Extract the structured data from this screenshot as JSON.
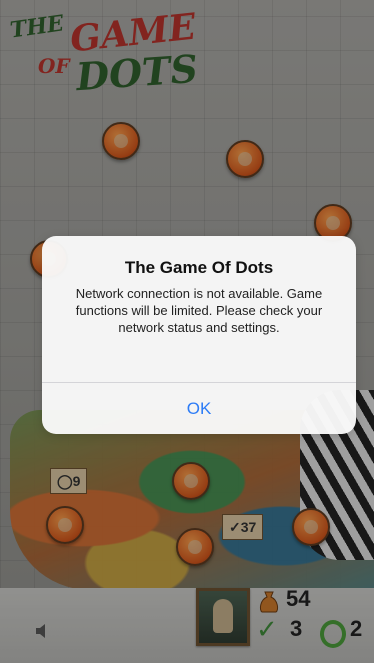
{
  "alert": {
    "title": "The Game Of Dots",
    "message": "Network connection is not available. Game functions will be limited. Please check your network status and settings.",
    "ok_label": "OK"
  },
  "logo": {
    "word_the": "THE",
    "word_game": "GAME",
    "word_of": "OF",
    "word_dots": "DOTS"
  },
  "board": {
    "plaque_left": "9",
    "plaque_right": "37"
  },
  "stats": {
    "coins": "54",
    "checks": "3",
    "rings": "2"
  },
  "colors": {
    "accent": "#2d7cf6",
    "dot": "#d0561c"
  }
}
